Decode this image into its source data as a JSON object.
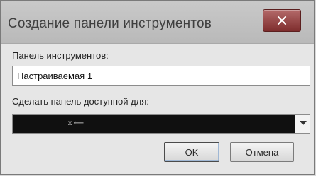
{
  "dialog": {
    "title": "Создание панели инструментов",
    "close_icon": "close-icon"
  },
  "form": {
    "toolbar_label": "Панель инструментов:",
    "toolbar_name_value": "Настраиваемая 1",
    "available_label": "Сделать панель доступной для:",
    "available_value": "x ⟵"
  },
  "buttons": {
    "ok_label": "OK",
    "cancel_label": "Отмена"
  }
}
